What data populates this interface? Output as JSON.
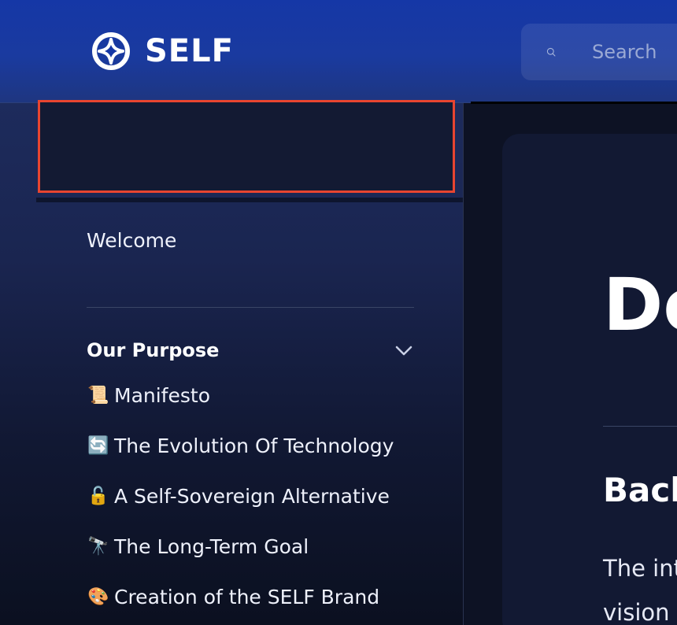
{
  "header": {
    "logo_text": "SELF",
    "search_placeholder": "Search"
  },
  "sidebar": {
    "welcome_label": "Welcome",
    "section_title": "Our Purpose",
    "items": [
      {
        "emoji": "📜",
        "label": "Manifesto"
      },
      {
        "emoji": "🔄",
        "label": "The Evolution Of Technology"
      },
      {
        "emoji": "🔓",
        "label": "A Self-Sovereign Alternative"
      },
      {
        "emoji": "🔭",
        "label": "The Long-Term Goal"
      },
      {
        "emoji": "🎨",
        "label": "Creation of the SELF Brand"
      }
    ]
  },
  "main": {
    "title": "Do",
    "heading": "Back",
    "para_line1": "The int",
    "para_line2": "vision"
  },
  "colors": {
    "header_blue": "#1537a6",
    "highlight_border": "#e84530",
    "sidebar_bg": "#111833"
  }
}
